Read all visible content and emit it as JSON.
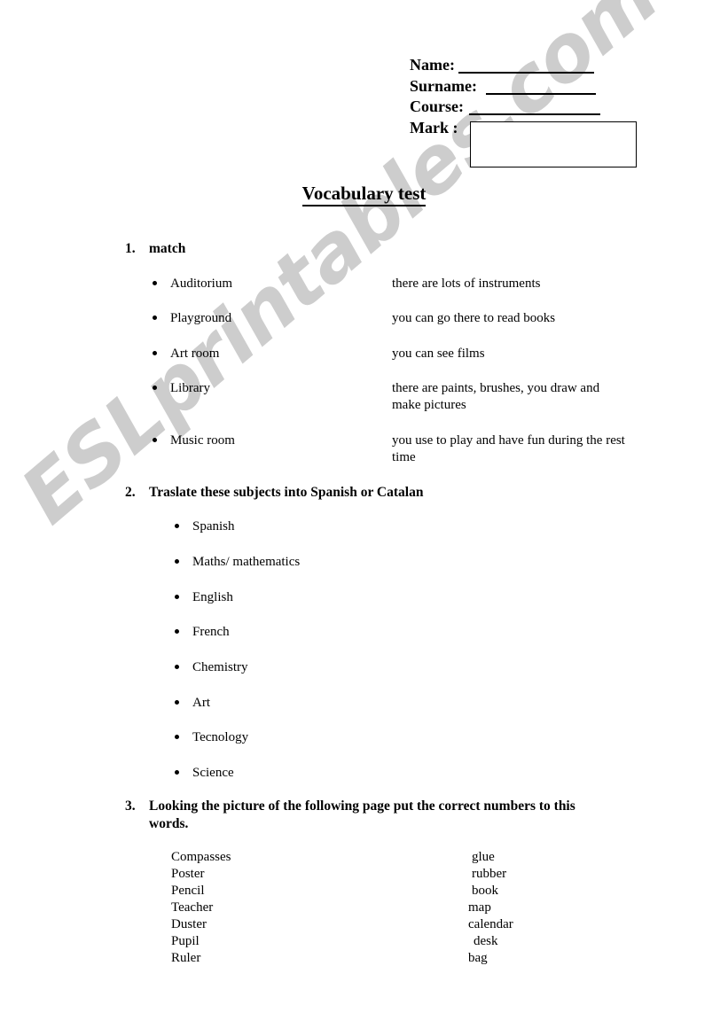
{
  "document": {
    "title": "Vocabulary test",
    "watermark": "ESLprintables.com",
    "watermark_color": "#cdcdcd"
  },
  "header": {
    "fields": [
      {
        "label": "Name:",
        "value": ""
      },
      {
        "label": "Surname:",
        "value": ""
      },
      {
        "label": "Course:",
        "value": ""
      }
    ],
    "mark": {
      "label": "Mark :",
      "value": ""
    }
  },
  "exercises": [
    {
      "number": "1.",
      "instruction": "match",
      "pairs": [
        {
          "term": "Auditorium",
          "clue": "there are lots of instruments"
        },
        {
          "term": "Playground",
          "clue": "you can go there to read books"
        },
        {
          "term": "Art room",
          "clue": "you can see films"
        },
        {
          "term": "Library",
          "clue": "there are paints, brushes, you draw and make pictures"
        },
        {
          "term": "Music room",
          "clue": "you use to play and have fun during the rest time"
        }
      ]
    },
    {
      "number": "2.",
      "instruction": "Traslate these subjects into Spanish or Catalan",
      "subjects": [
        "Spanish",
        "Maths/ mathematics",
        "English",
        "French",
        "Chemistry",
        "Art",
        "Tecnology",
        "Science"
      ]
    },
    {
      "number": "3.",
      "instruction": "Looking the picture of the following page put the correct numbers to this words.",
      "words_left": [
        "Compasses",
        "Poster",
        "Pencil",
        "Teacher",
        "Duster",
        "Pupil",
        "Ruler"
      ],
      "words_right": [
        "glue",
        "rubber",
        "book",
        "map",
        "calendar",
        "desk",
        "bag"
      ]
    }
  ]
}
